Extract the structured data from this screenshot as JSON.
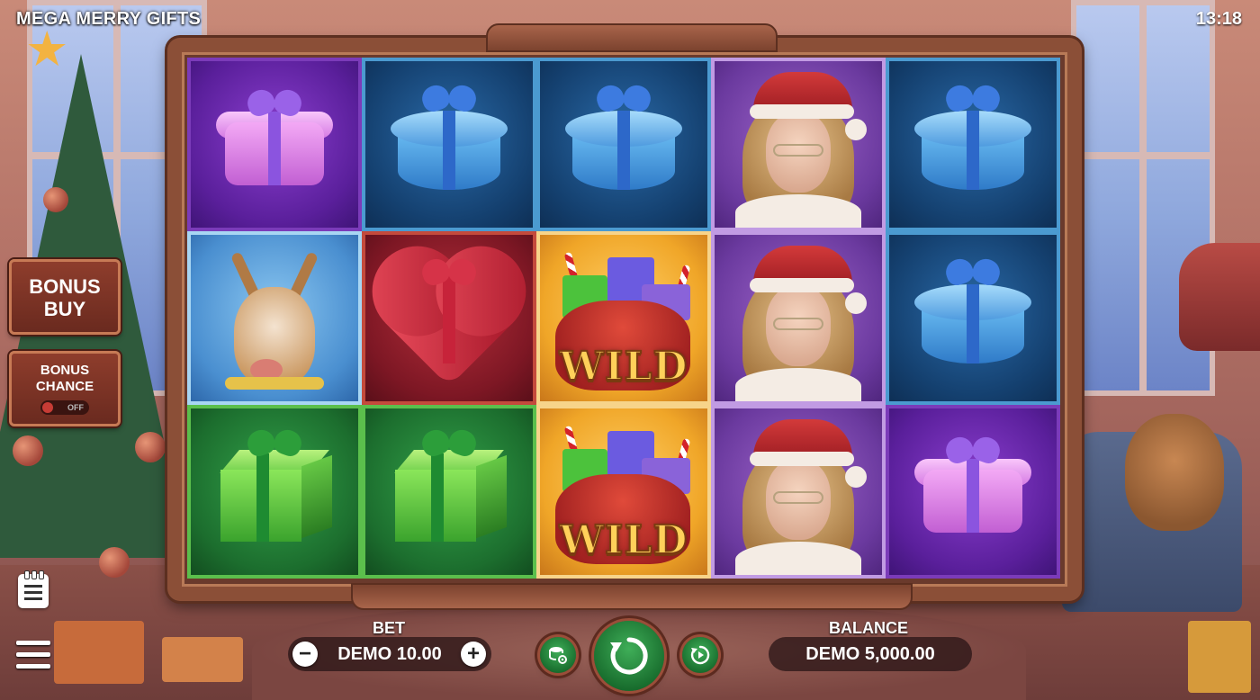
{
  "game": {
    "title": "MEGA MERRY GIFTS",
    "clock": "13:18"
  },
  "side_panel": {
    "bonus_buy_line1": "BONUS",
    "bonus_buy_line2": "BUY",
    "bonus_chance_line1": "BONUS",
    "bonus_chance_line2": "CHANCE",
    "bonus_chance_toggle": "OFF"
  },
  "reels": {
    "rows": [
      [
        "purple-hex-gift",
        "blue-round-gift",
        "blue-round-gift",
        "santa-woman",
        "blue-round-gift"
      ],
      [
        "reindeer",
        "red-heart-gift",
        "wild",
        "santa-woman",
        "blue-round-gift"
      ],
      [
        "green-cube-gift",
        "green-cube-gift",
        "wild",
        "santa-woman",
        "purple-hex-gift"
      ]
    ],
    "wild_label": "WILD"
  },
  "bottom_bar": {
    "bet_label": "BET",
    "bet_value": "DEMO 10.00",
    "minus": "−",
    "plus": "+",
    "balance_label": "BALANCE",
    "balance_value": "DEMO 5,000.00"
  },
  "colors": {
    "frame": "#8b4f37",
    "spin_button": "#1f7a35",
    "title_text": "#ffffff"
  },
  "icons": [
    "menu-icon",
    "paytable-icon",
    "autoplay-settings-icon",
    "spin-icon",
    "turbo-icon",
    "minus-icon",
    "plus-icon"
  ]
}
